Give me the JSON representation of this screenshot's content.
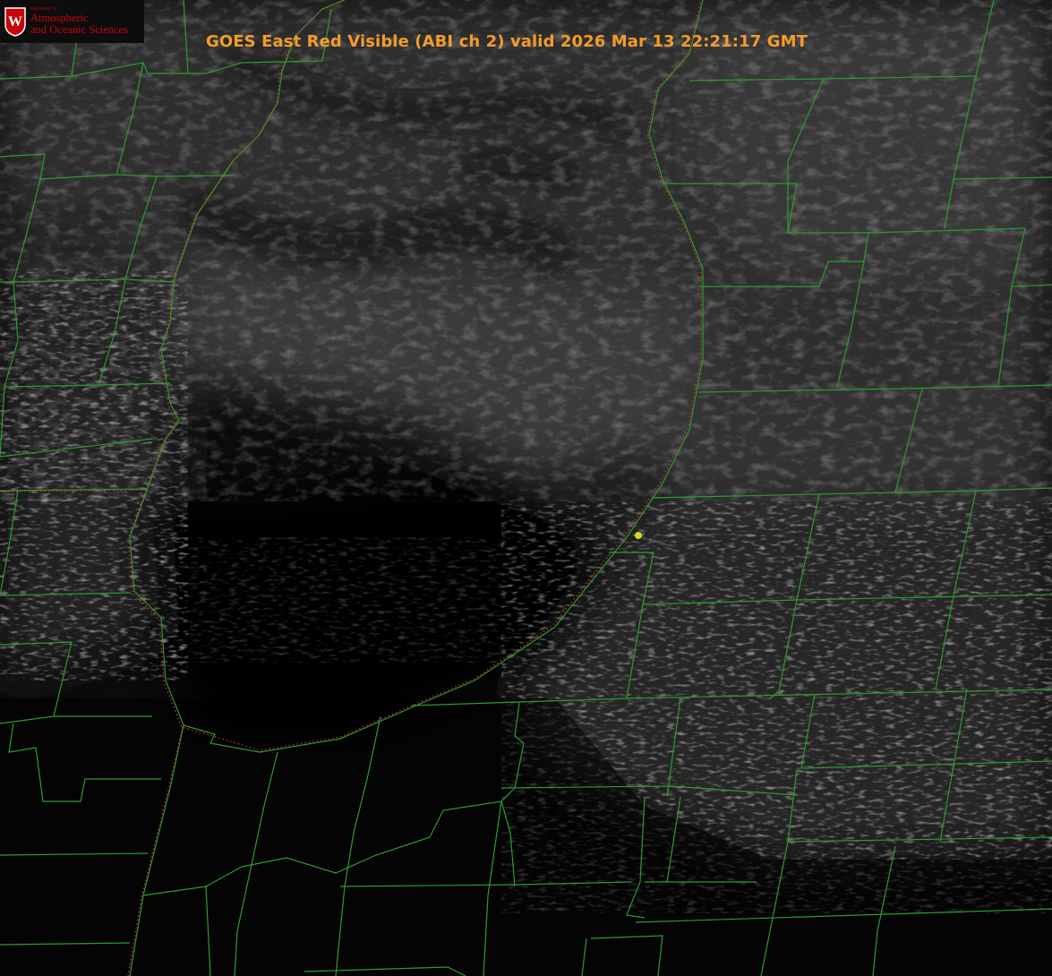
{
  "logo": {
    "crest_letter": "W",
    "department_small": "Department of",
    "line1": "Atmospheric",
    "line2": "and Oceanic Sciences"
  },
  "title": "GOES East Red Visible (ABI ch 2) valid 2026 Mar 13 22:21:17 GMT",
  "colors": {
    "background": "#000000",
    "county_lines": "#2f9a2f",
    "shoreline_dots": "#d8322a",
    "title_text": "#f39c2a",
    "logo_red": "#c5050c",
    "marker": "#d9d51e"
  },
  "map": {
    "features": [
      "cloud-field",
      "lake-shoreline",
      "county-boundaries",
      "station-marker"
    ]
  }
}
